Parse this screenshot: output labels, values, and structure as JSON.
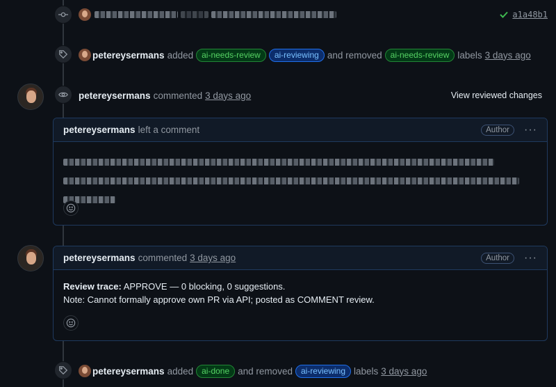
{
  "commit": {
    "hash": "a1a48b1",
    "status_icon": "check-icon",
    "status_color": "#3fb950"
  },
  "events": [
    {
      "type": "labeled",
      "user": "petereysermans",
      "added_text": "added",
      "added_labels": [
        {
          "name": "ai-needs-review",
          "color": "green"
        },
        {
          "name": "ai-reviewing",
          "color": "blue"
        }
      ],
      "removed_text": "and removed",
      "removed_labels": [
        {
          "name": "ai-needs-review",
          "color": "green"
        }
      ],
      "labels_text": "labels",
      "time": "3 days ago"
    },
    {
      "type": "labeled",
      "user": "petereysermans",
      "added_text": "added",
      "added_labels": [
        {
          "name": "ai-done",
          "color": "green"
        }
      ],
      "removed_text": "and removed",
      "removed_labels": [
        {
          "name": "ai-reviewing",
          "color": "blue"
        }
      ],
      "labels_text": "labels",
      "time": "3 days ago"
    }
  ],
  "review_event": {
    "user": "petereysermans",
    "action": "commented",
    "time": "3 days ago",
    "view_link": "View reviewed changes"
  },
  "comment1": {
    "user": "petereysermans",
    "action": "left a comment",
    "badge": "Author",
    "menu": "···"
  },
  "comment2": {
    "user": "petereysermans",
    "action": "commented",
    "time": "3 days ago",
    "badge": "Author",
    "menu": "···",
    "line1_bold": "Review trace:",
    "line1_rest": "APPROVE — 0 blocking, 0 suggestions.",
    "line2": "Note: Cannot formally approve own PR via API; posted as COMMENT review."
  }
}
